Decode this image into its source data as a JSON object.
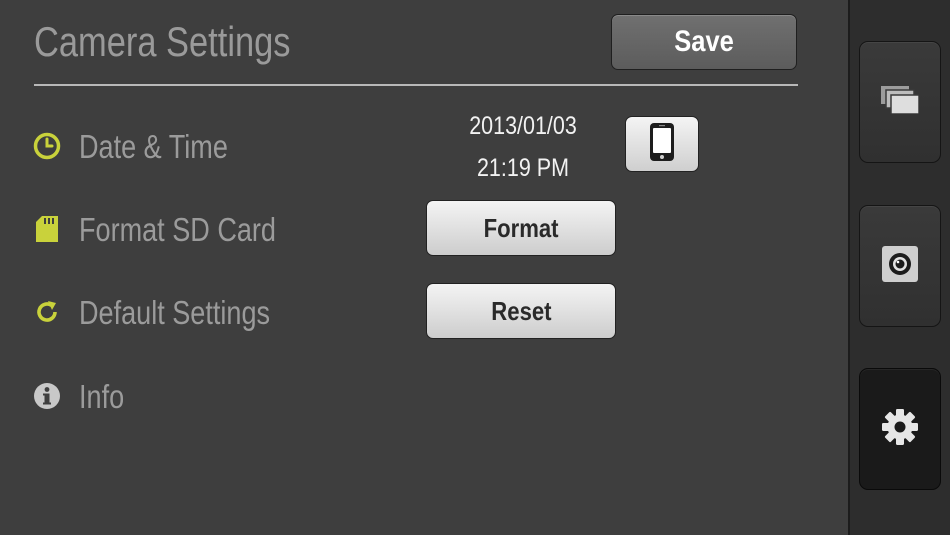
{
  "header": {
    "title": "Camera Settings",
    "save_label": "Save"
  },
  "rows": [
    {
      "label": "Date & Time",
      "icon": "clock-icon"
    },
    {
      "label": "Format SD Card",
      "icon": "sd-card-icon"
    },
    {
      "label": "Default Settings",
      "icon": "refresh-icon"
    },
    {
      "label": "Info",
      "icon": "info-icon"
    }
  ],
  "datetime": {
    "date": "2013/01/03",
    "time": "21:19 PM",
    "sync_icon": "phone-icon"
  },
  "buttons": {
    "format_label": "Format",
    "reset_label": "Reset"
  },
  "sidebar": {
    "items": [
      {
        "icon": "gallery-icon",
        "active": false
      },
      {
        "icon": "camera-icon",
        "active": false
      },
      {
        "icon": "gear-icon",
        "active": true
      }
    ]
  },
  "colors": {
    "accent": "#c9d23b",
    "background": "#3e3e3e",
    "sidebar": "#2d2d2d",
    "label": "#9b9b9b"
  }
}
